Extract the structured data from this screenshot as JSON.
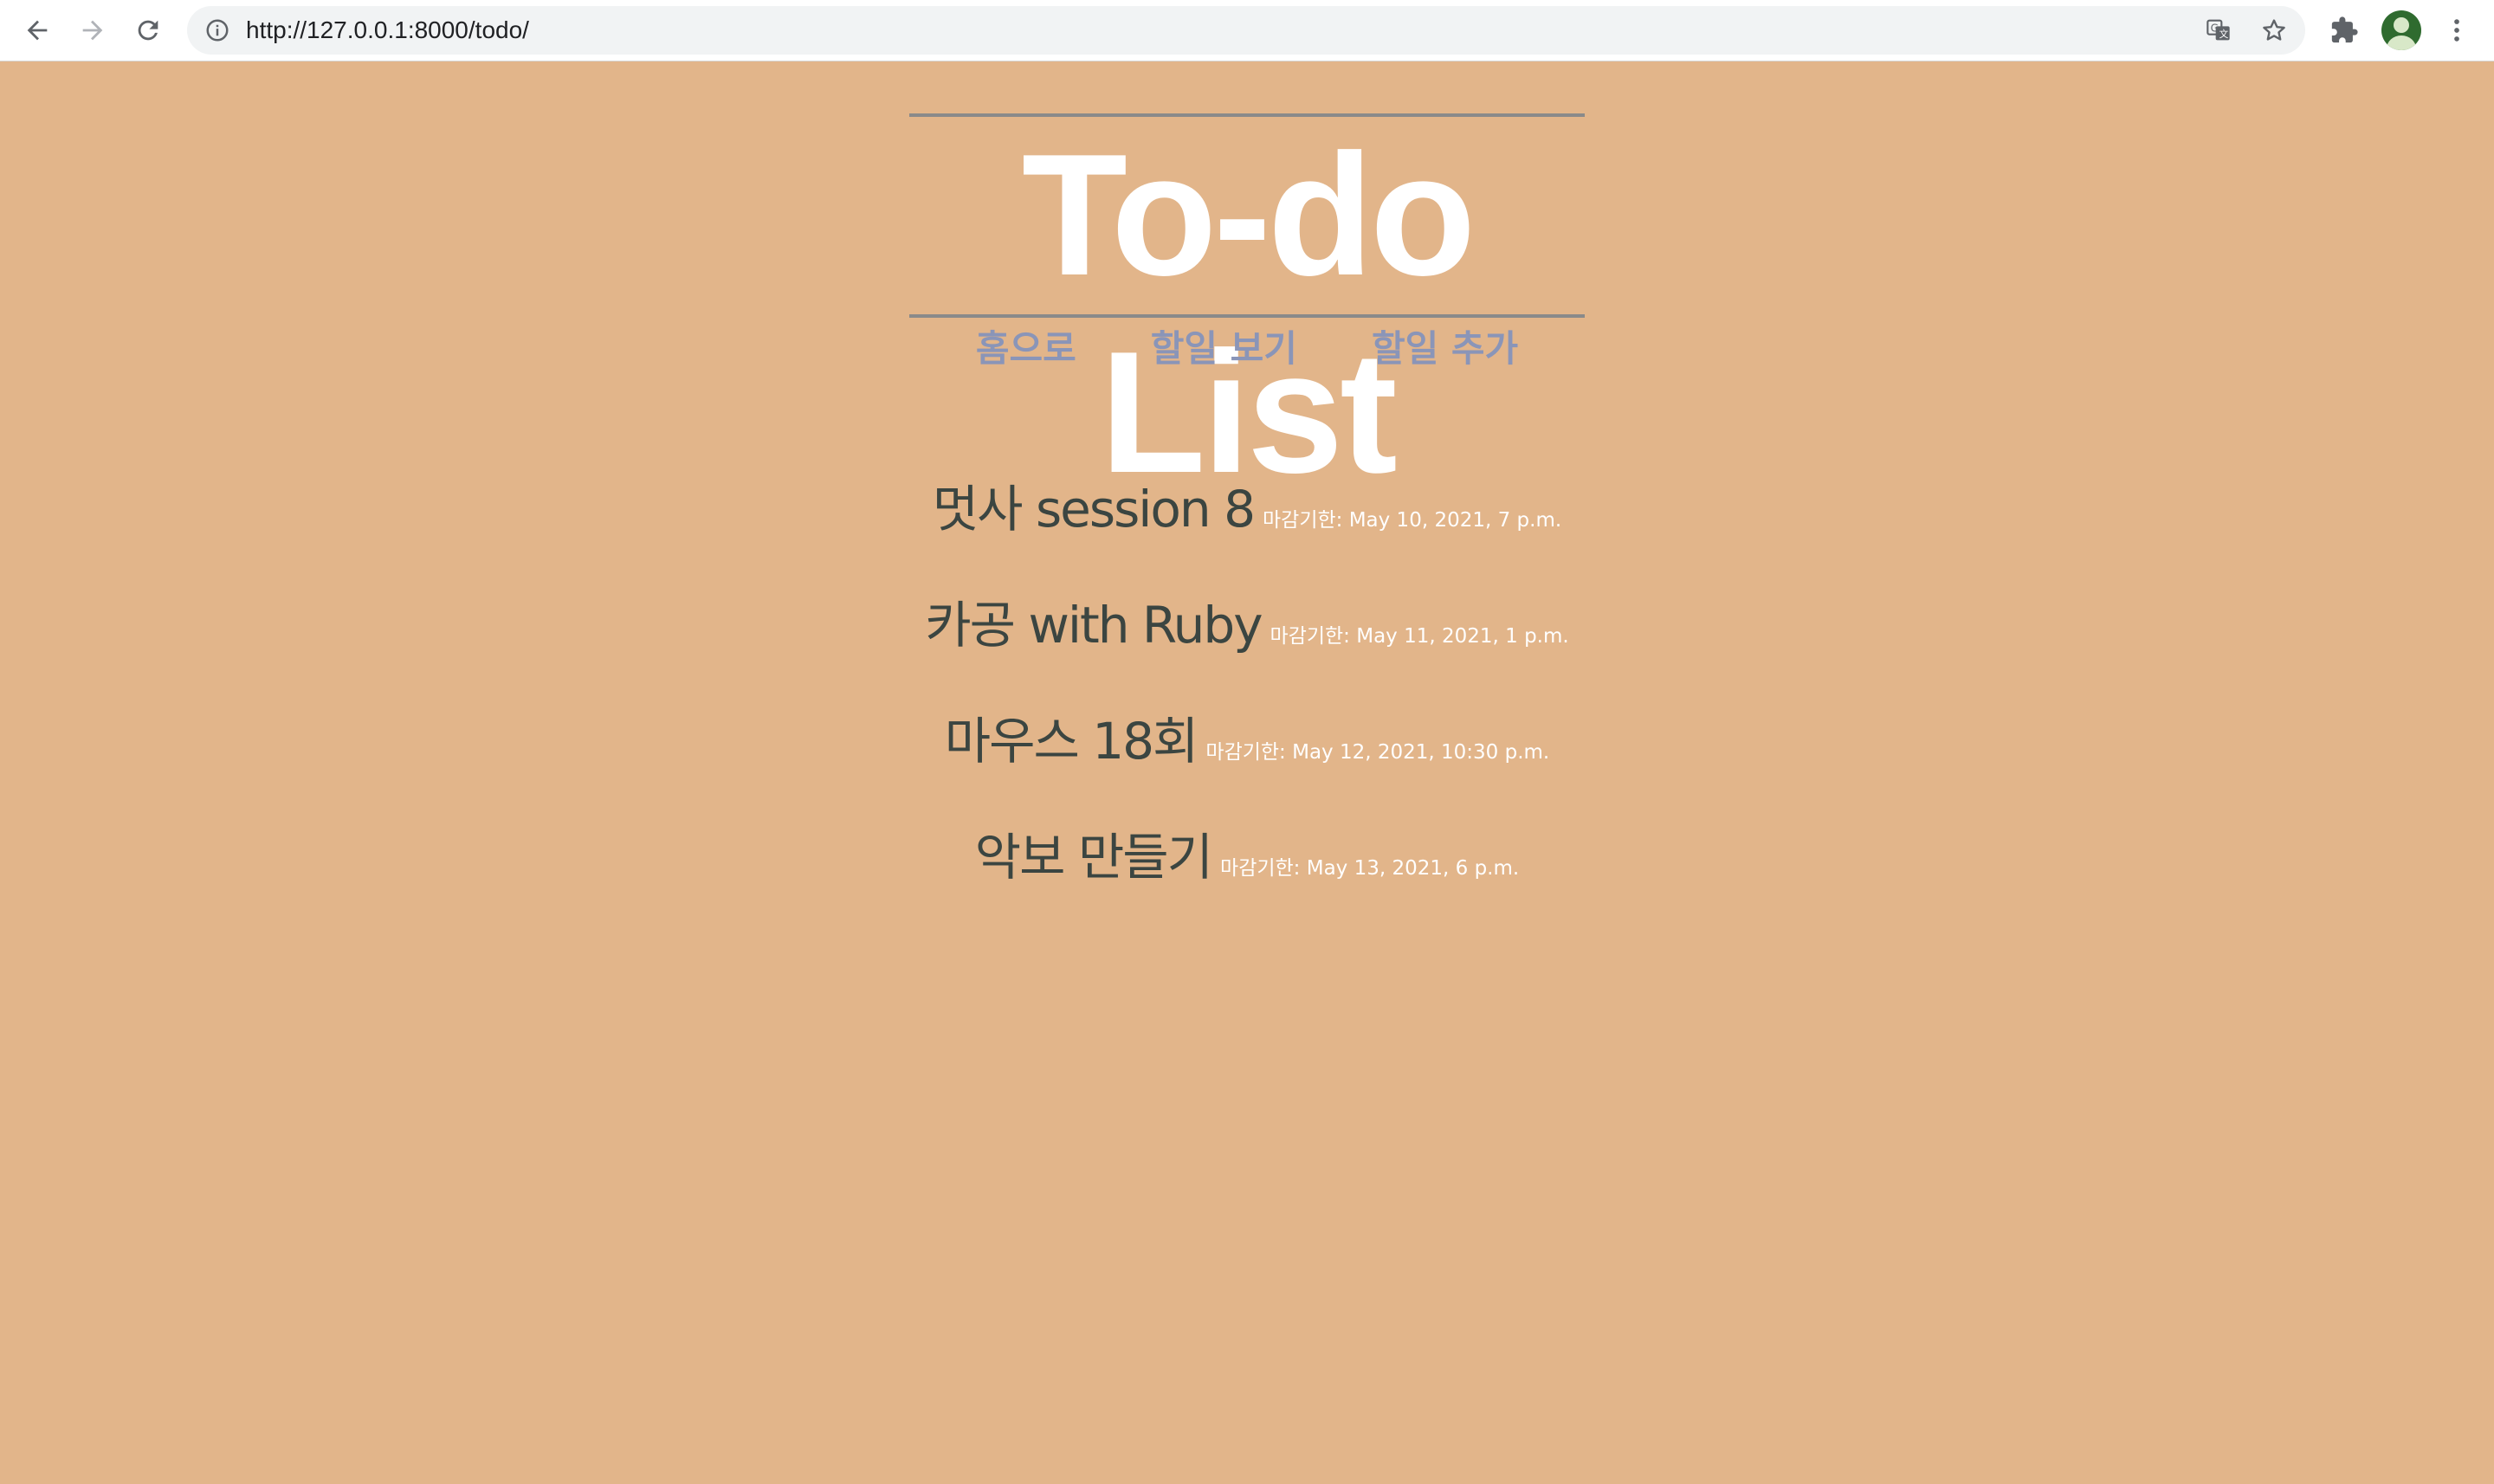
{
  "browser": {
    "url": "http://127.0.0.1:8000/todo/",
    "icons": {
      "back": "back-arrow-icon",
      "forward": "forward-arrow-icon",
      "reload": "reload-icon",
      "info": "info-icon",
      "translate": "translate-icon",
      "bookmark": "star-icon",
      "extensions": "puzzle-icon",
      "profile": "avatar",
      "menu": "kebab-menu-icon"
    }
  },
  "header": {
    "title": "To-do List",
    "nav": [
      "홈으로",
      "할일 보기",
      "할일 추가"
    ]
  },
  "todos": [
    {
      "title": "멋사 session 8",
      "due": "마감기한: May 10, 2021, 7 p.m."
    },
    {
      "title": "카공 with Ruby",
      "due": "마감기한: May 11, 2021, 1 p.m."
    },
    {
      "title": "마우스 18회",
      "due": "마감기한: May 12, 2021, 10:30 p.m."
    },
    {
      "title": "악보 만들기",
      "due": "마감기한: May 13, 2021, 6 p.m."
    }
  ],
  "colors": {
    "page_background": "#e2b58a",
    "title": "#ffffff",
    "nav_link": "#8a95b8",
    "todo_title": "#3b4541",
    "todo_due": "#ffffff",
    "rule": "#8a8a8a"
  }
}
